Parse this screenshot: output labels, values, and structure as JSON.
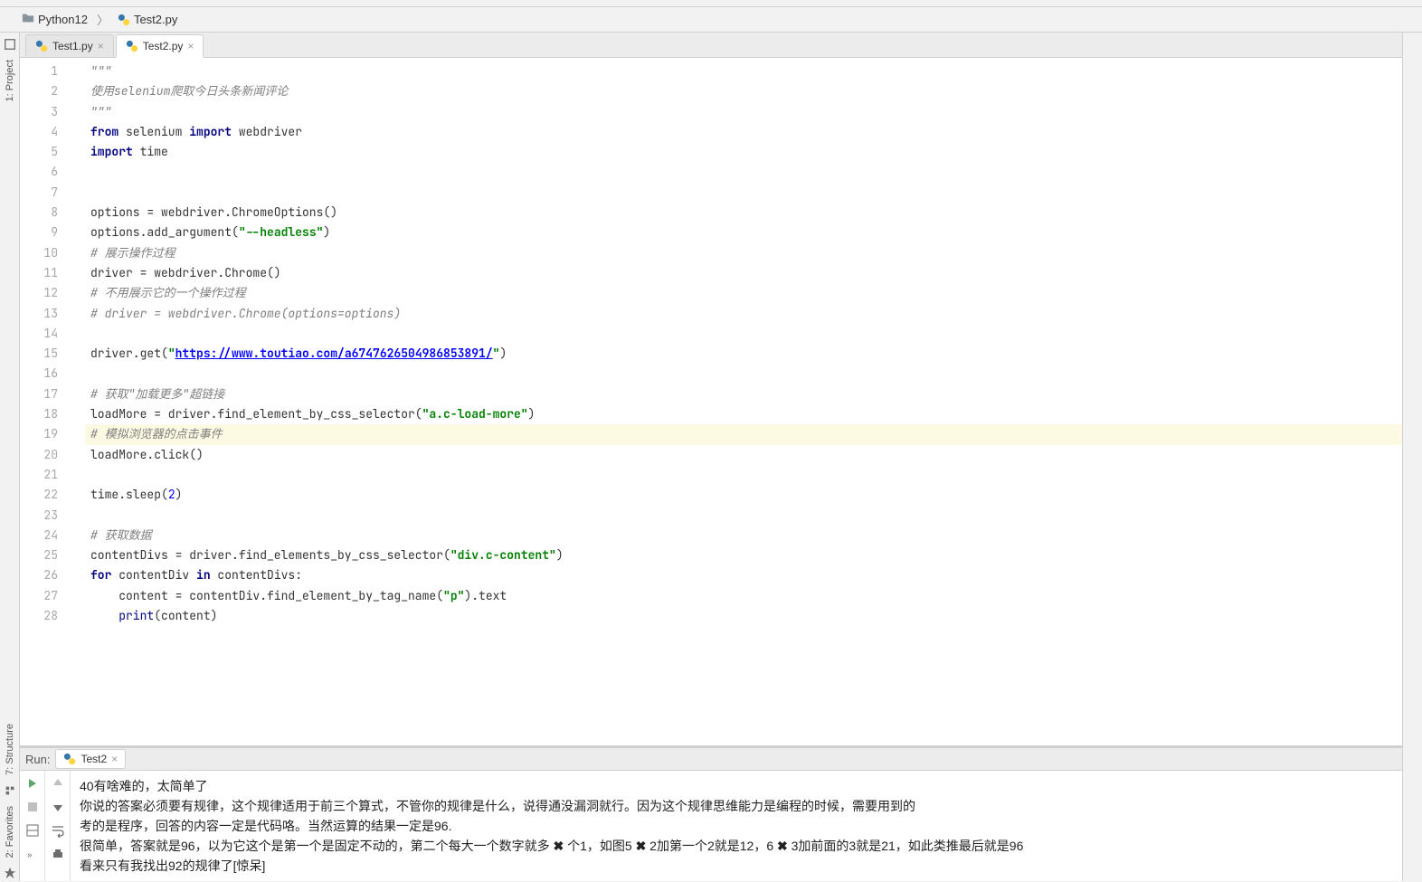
{
  "breadcrumb": {
    "project": "Python12",
    "file": "Test2.py"
  },
  "editorTabs": [
    {
      "label": "Test1.py",
      "active": false
    },
    {
      "label": "Test2.py",
      "active": true
    }
  ],
  "leftGutter": {
    "project": "1: Project",
    "structure": "7: Structure",
    "favorites": "2: Favorites"
  },
  "code": {
    "lines": [
      {
        "n": 1,
        "t": "com",
        "text": "\"\"\""
      },
      {
        "n": 2,
        "t": "com",
        "text": "使用selenium爬取今日头条新闻评论"
      },
      {
        "n": 3,
        "t": "com",
        "text": "\"\"\""
      },
      {
        "n": 4,
        "t": "imp1",
        "kw1": "from",
        "m1": " selenium ",
        "kw2": "import",
        "m2": " webdriver"
      },
      {
        "n": 5,
        "t": "imp2",
        "kw1": "import",
        "m1": " time"
      },
      {
        "n": 6,
        "t": "blank",
        "text": ""
      },
      {
        "n": 7,
        "t": "blank",
        "text": ""
      },
      {
        "n": 8,
        "t": "plain",
        "text": "options = webdriver.ChromeOptions()"
      },
      {
        "n": 9,
        "t": "arg",
        "pre": "options.add_argument(",
        "str": "\"--headless\"",
        "post": ")"
      },
      {
        "n": 10,
        "t": "com",
        "text": "# 展示操作过程"
      },
      {
        "n": 11,
        "t": "plain",
        "text": "driver = webdriver.Chrome()"
      },
      {
        "n": 12,
        "t": "com",
        "text": "# 不用展示它的一个操作过程"
      },
      {
        "n": 13,
        "t": "com",
        "text": "# driver = webdriver.Chrome(options=options)"
      },
      {
        "n": 14,
        "t": "blank",
        "text": ""
      },
      {
        "n": 15,
        "t": "url",
        "pre": "driver.get(",
        "q": "\"",
        "url": "https://www.toutiao.com/a6747626504986853891/",
        "post": ")"
      },
      {
        "n": 16,
        "t": "blank",
        "text": ""
      },
      {
        "n": 17,
        "t": "com",
        "text": "# 获取\"加载更多\"超链接"
      },
      {
        "n": 18,
        "t": "arg",
        "pre": "loadMore = driver.find_element_by_css_selector(",
        "str": "\"a.c-load-more\"",
        "post": ")"
      },
      {
        "n": 19,
        "t": "com",
        "text": "# 模拟浏览器的点击事件",
        "hl": true
      },
      {
        "n": 20,
        "t": "plain",
        "text": "loadMore.click()"
      },
      {
        "n": 21,
        "t": "blank",
        "text": ""
      },
      {
        "n": 22,
        "t": "num",
        "pre": "time.sleep(",
        "num": "2",
        "post": ")"
      },
      {
        "n": 23,
        "t": "blank",
        "text": ""
      },
      {
        "n": 24,
        "t": "com",
        "text": "# 获取数据"
      },
      {
        "n": 25,
        "t": "arg",
        "pre": "contentDivs = driver.find_elements_by_css_selector(",
        "str": "\"div.c-content\"",
        "post": ")"
      },
      {
        "n": 26,
        "t": "for",
        "kw1": "for",
        "m1": " contentDiv ",
        "kw2": "in",
        "m2": " contentDivs:"
      },
      {
        "n": 27,
        "t": "arg",
        "pre": "    content = contentDiv.find_element_by_tag_name(",
        "str": "\"p\"",
        "post": ").text"
      },
      {
        "n": 28,
        "t": "print",
        "pre": "    ",
        "fn": "print",
        "post": "(content)"
      }
    ]
  },
  "run": {
    "label": "Run:",
    "tab": "Test2",
    "output": [
      "40有啥难的，太简单了",
      "你说的答案必须要有规律，这个规律适用于前三个算式，不管你的规律是什么，说得通没漏洞就行。因为这个规律思维能力是编程的时候，需要用到的",
      "考的是程序，回答的内容一定是代码咯。当然运算的结果一定是96.",
      "很简单，答案就是96，以为它这个是第一个是固定不动的，第二个每大一个数字就多 ✖     个1，如图5 ✖     2加第一个2就是12，6 ✖     3加前面的3就是21，如此类推最后就是96",
      "看来只有我找出92的规律了[惊呆]"
    ]
  }
}
